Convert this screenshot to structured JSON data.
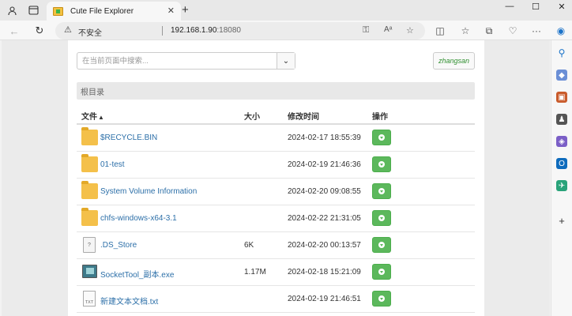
{
  "browser": {
    "tab_title": "Cute File Explorer",
    "tab_close": "✕",
    "new_tab": "+",
    "security_label": "不安全",
    "url_host": "192.168.1.90",
    "url_port": ":18080",
    "window_controls": [
      "—",
      "☐",
      "✕"
    ]
  },
  "page": {
    "search_placeholder": "在当前页面中搜索...",
    "search_dropdown": "⌄",
    "user_button": "zhangsan",
    "breadcrumb": "根目录",
    "columns": {
      "name": "文件",
      "name_sort": "▲",
      "size": "大小",
      "modified": "修改时间",
      "actions": "操作"
    },
    "files": [
      {
        "name": "$RECYCLE.BIN",
        "type": "folder",
        "size": "",
        "modified": "2024-02-17 18:55:39"
      },
      {
        "name": "01-test",
        "type": "folder",
        "size": "",
        "modified": "2024-02-19 21:46:36"
      },
      {
        "name": "System Volume Information",
        "type": "folder",
        "size": "",
        "modified": "2024-02-20 09:08:55"
      },
      {
        "name": "chfs-windows-x64-3.1",
        "type": "folder",
        "size": "",
        "modified": "2024-02-22 21:31:05"
      },
      {
        "name": ".DS_Store",
        "type": "file",
        "size": "6K",
        "modified": "2024-02-20 00:13:57"
      },
      {
        "name": "SocketTool_副本.exe",
        "type": "exe",
        "size": "1.17M",
        "modified": "2024-02-18 15:21:09"
      },
      {
        "name": "新建文本文档.txt",
        "type": "txt",
        "size": "",
        "modified": "2024-02-19 21:46:51"
      }
    ]
  },
  "colors": {
    "link": "#2c6fa8",
    "download_button": "#5cb85c",
    "folder": "#f4c04a",
    "user_button_text": "#2f8f2f"
  }
}
